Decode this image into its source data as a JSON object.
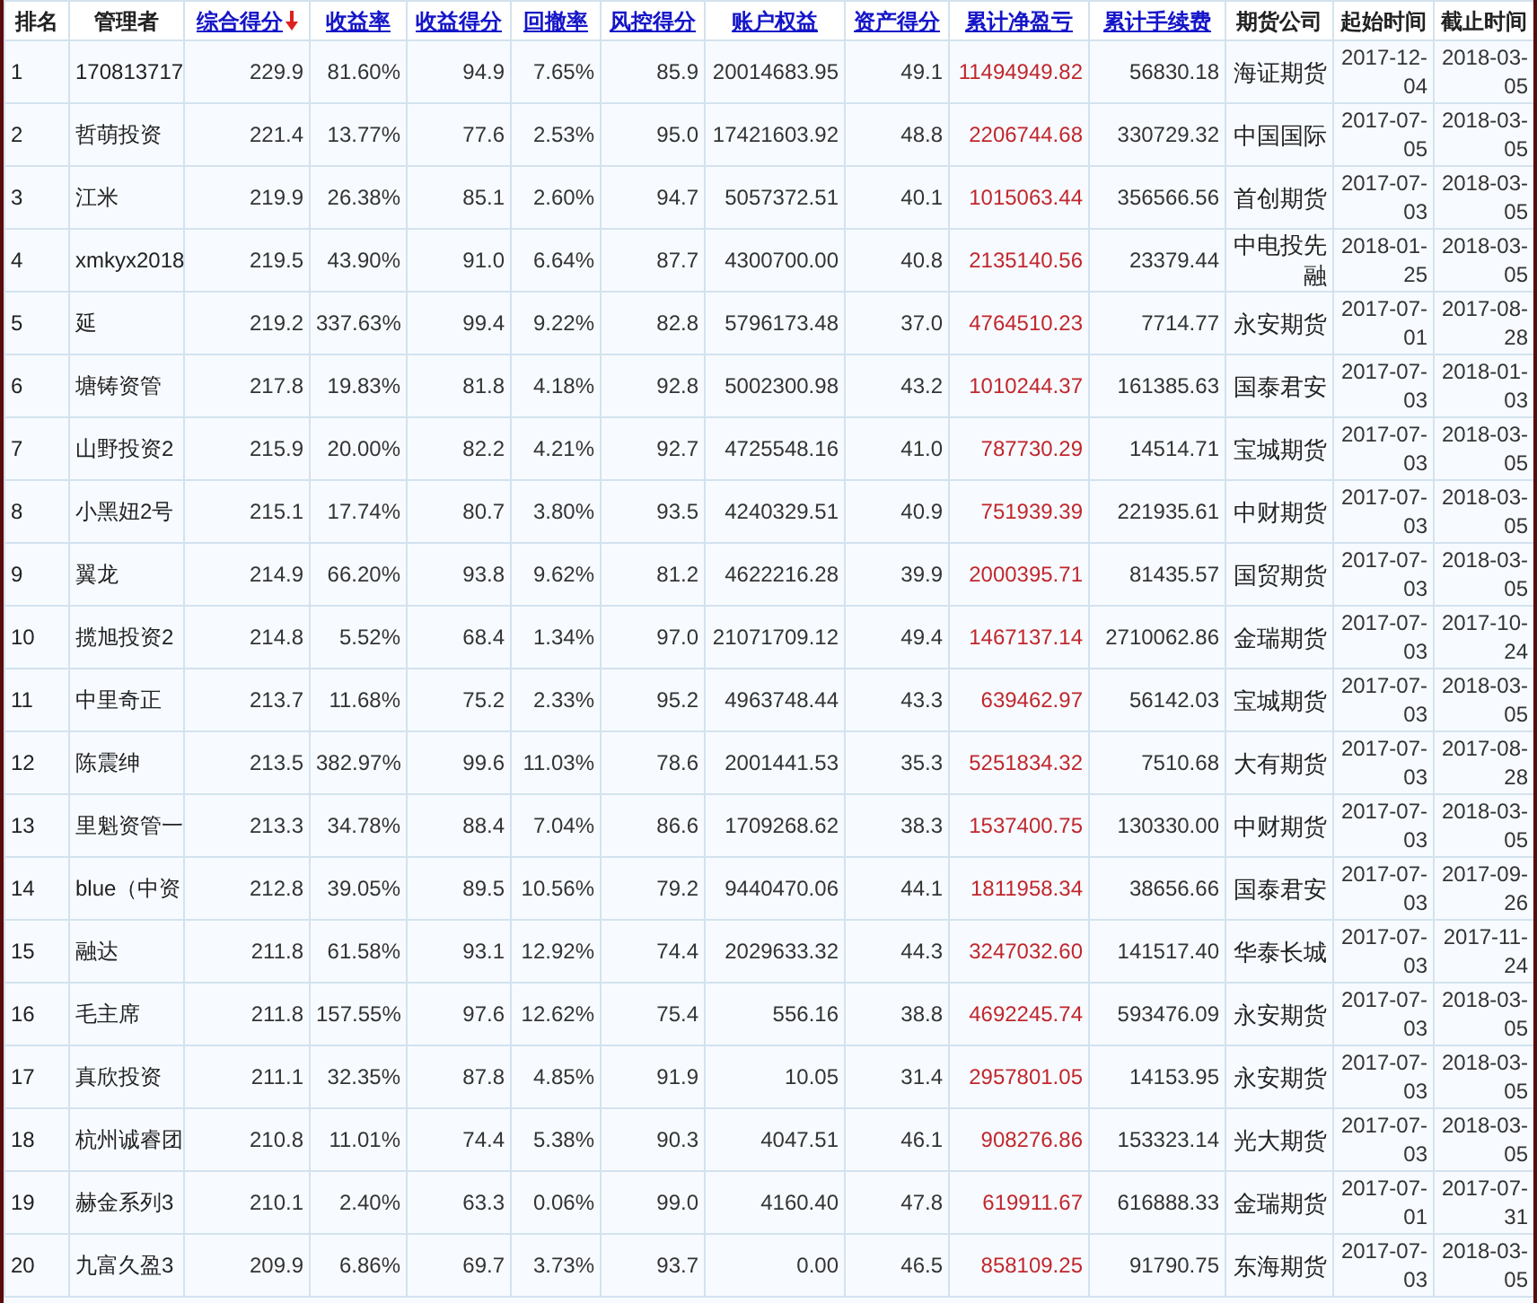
{
  "columns": [
    {
      "label": "排名",
      "link": false,
      "kind": "text"
    },
    {
      "label": "管理者",
      "link": false,
      "kind": "text"
    },
    {
      "label": "综合得分",
      "link": true,
      "kind": "number",
      "sorted": true
    },
    {
      "label": "收益率",
      "link": true,
      "kind": "number"
    },
    {
      "label": "收益得分",
      "link": true,
      "kind": "number"
    },
    {
      "label": "回撤率",
      "link": true,
      "kind": "number"
    },
    {
      "label": "风控得分",
      "link": true,
      "kind": "number"
    },
    {
      "label": "账户权益",
      "link": true,
      "kind": "number"
    },
    {
      "label": "资产得分",
      "link": true,
      "kind": "number"
    },
    {
      "label": "累计净盈亏",
      "link": true,
      "kind": "loss"
    },
    {
      "label": "累计手续费",
      "link": true,
      "kind": "number"
    },
    {
      "label": "期货公司",
      "link": false,
      "kind": "company"
    },
    {
      "label": "起始时间",
      "link": false,
      "kind": "date"
    },
    {
      "label": "截止时间",
      "link": false,
      "kind": "date"
    }
  ],
  "rows": [
    [
      "1",
      "170813717",
      "229.9",
      "81.60%",
      "94.9",
      "7.65%",
      "85.9",
      "20014683.95",
      "49.1",
      "11494949.82",
      "56830.18",
      "海证期货",
      "2017-12-04",
      "2018-03-05"
    ],
    [
      "2",
      "哲萌投资",
      "221.4",
      "13.77%",
      "77.6",
      "2.53%",
      "95.0",
      "17421603.92",
      "48.8",
      "2206744.68",
      "330729.32",
      "中国国际",
      "2017-07-05",
      "2018-03-05"
    ],
    [
      "3",
      "江米",
      "219.9",
      "26.38%",
      "85.1",
      "2.60%",
      "94.7",
      "5057372.51",
      "40.1",
      "1015063.44",
      "356566.56",
      "首创期货",
      "2017-07-03",
      "2018-03-05"
    ],
    [
      "4",
      "xmkyx2018",
      "219.5",
      "43.90%",
      "91.0",
      "6.64%",
      "87.7",
      "4300700.00",
      "40.8",
      "2135140.56",
      "23379.44",
      "中电投先融",
      "2018-01-25",
      "2018-03-05"
    ],
    [
      "5",
      "延",
      "219.2",
      "337.63%",
      "99.4",
      "9.22%",
      "82.8",
      "5796173.48",
      "37.0",
      "4764510.23",
      "7714.77",
      "永安期货",
      "2017-07-01",
      "2017-08-28"
    ],
    [
      "6",
      "塘铸资管",
      "217.8",
      "19.83%",
      "81.8",
      "4.18%",
      "92.8",
      "5002300.98",
      "43.2",
      "1010244.37",
      "161385.63",
      "国泰君安",
      "2017-07-03",
      "2018-01-03"
    ],
    [
      "7",
      "山野投资2",
      "215.9",
      "20.00%",
      "82.2",
      "4.21%",
      "92.7",
      "4725548.16",
      "41.0",
      "787730.29",
      "14514.71",
      "宝城期货",
      "2017-07-03",
      "2018-03-05"
    ],
    [
      "8",
      "小黑妞2号",
      "215.1",
      "17.74%",
      "80.7",
      "3.80%",
      "93.5",
      "4240329.51",
      "40.9",
      "751939.39",
      "221935.61",
      "中财期货",
      "2017-07-03",
      "2018-03-05"
    ],
    [
      "9",
      "翼龙",
      "214.9",
      "66.20%",
      "93.8",
      "9.62%",
      "81.2",
      "4622216.28",
      "39.9",
      "2000395.71",
      "81435.57",
      "国贸期货",
      "2017-07-03",
      "2018-03-05"
    ],
    [
      "10",
      "揽旭投资2",
      "214.8",
      "5.52%",
      "68.4",
      "1.34%",
      "97.0",
      "21071709.12",
      "49.4",
      "1467137.14",
      "2710062.86",
      "金瑞期货",
      "2017-07-03",
      "2017-10-24"
    ],
    [
      "11",
      "中里奇正",
      "213.7",
      "11.68%",
      "75.2",
      "2.33%",
      "95.2",
      "4963748.44",
      "43.3",
      "639462.97",
      "56142.03",
      "宝城期货",
      "2017-07-03",
      "2018-03-05"
    ],
    [
      "12",
      "陈震绅",
      "213.5",
      "382.97%",
      "99.6",
      "11.03%",
      "78.6",
      "2001441.53",
      "35.3",
      "5251834.32",
      "7510.68",
      "大有期货",
      "2017-07-03",
      "2017-08-28"
    ],
    [
      "13",
      "里魁资管一",
      "213.3",
      "34.78%",
      "88.4",
      "7.04%",
      "86.6",
      "1709268.62",
      "38.3",
      "1537400.75",
      "130330.00",
      "中财期货",
      "2017-07-03",
      "2018-03-05"
    ],
    [
      "14",
      "blue（中资",
      "212.8",
      "39.05%",
      "89.5",
      "10.56%",
      "79.2",
      "9440470.06",
      "44.1",
      "1811958.34",
      "38656.66",
      "国泰君安",
      "2017-07-03",
      "2017-09-26"
    ],
    [
      "15",
      "融达",
      "211.8",
      "61.58%",
      "93.1",
      "12.92%",
      "74.4",
      "2029633.32",
      "44.3",
      "3247032.60",
      "141517.40",
      "华泰长城",
      "2017-07-03",
      "2017-11-24"
    ],
    [
      "16",
      "毛主席",
      "211.8",
      "157.55%",
      "97.6",
      "12.62%",
      "75.4",
      "556.16",
      "38.8",
      "4692245.74",
      "593476.09",
      "永安期货",
      "2017-07-03",
      "2018-03-05"
    ],
    [
      "17",
      "真欣投资",
      "211.1",
      "32.35%",
      "87.8",
      "4.85%",
      "91.9",
      "10.05",
      "31.4",
      "2957801.05",
      "14153.95",
      "永安期货",
      "2017-07-03",
      "2018-03-05"
    ],
    [
      "18",
      "杭州诚睿团",
      "210.8",
      "11.01%",
      "74.4",
      "5.38%",
      "90.3",
      "4047.51",
      "46.1",
      "908276.86",
      "153323.14",
      "光大期货",
      "2017-07-03",
      "2018-03-05"
    ],
    [
      "19",
      "赫金系列3",
      "210.1",
      "2.40%",
      "63.3",
      "0.06%",
      "99.0",
      "4160.40",
      "47.8",
      "619911.67",
      "616888.33",
      "金瑞期货",
      "2017-07-01",
      "2017-07-31"
    ],
    [
      "20",
      "九富久盈3",
      "209.9",
      "6.86%",
      "69.7",
      "3.73%",
      "93.7",
      "0.00",
      "46.5",
      "858109.25",
      "91790.75",
      "东海期货",
      "2017-07-03",
      "2018-03-05"
    ]
  ]
}
